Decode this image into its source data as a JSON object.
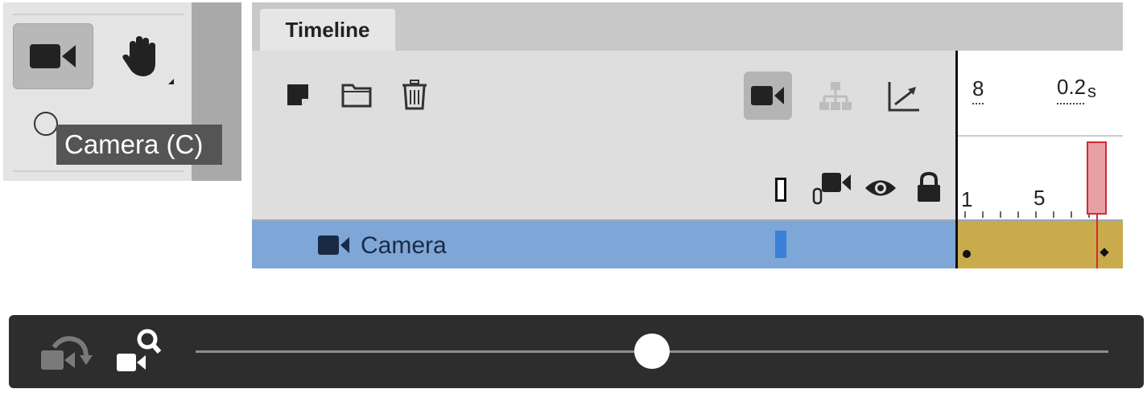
{
  "tools": {
    "tooltip": "Camera (C)"
  },
  "timeline": {
    "tab_label": "Timeline",
    "ruler": {
      "frame_top": "8",
      "time_label": "0.2",
      "time_unit": "s",
      "frame_1": "1",
      "frame_5": "5"
    },
    "layers": [
      {
        "name": "Camera",
        "icon": "camera-icon",
        "selected": true
      }
    ]
  },
  "colors": {
    "selected_row": "#7ea7d8",
    "frames_fill": "#c9ab4c",
    "playhead": "#d22a35",
    "layer_color": "#3a7fd8"
  },
  "camera_bar": {
    "zoom_slider_position": 0.5
  }
}
